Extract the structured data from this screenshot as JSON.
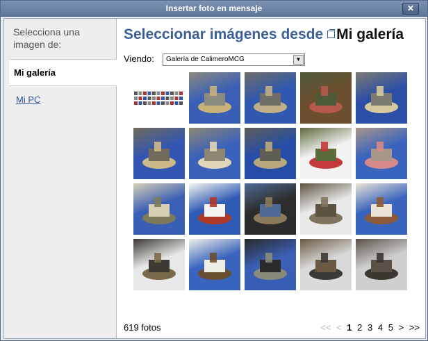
{
  "window": {
    "title": "Insertar foto en mensaje",
    "close_label": "✕"
  },
  "sidebar": {
    "heading": "Selecciona una imagen de:",
    "items": [
      {
        "label": "Mi galería",
        "active": true
      },
      {
        "label": "Mi PC",
        "active": false
      }
    ]
  },
  "main": {
    "heading_prefix": "Seleccionar imágenes desde",
    "heading_gallery": "Mi galería",
    "viewing_label": "Viendo:",
    "gallery_select_value": "Galería de CalimeroMCG"
  },
  "thumbnails": [
    {
      "name": "thumb-toolbar-screenshot",
      "type": "toolbar"
    },
    {
      "name": "thumb-model-1",
      "type": "photo",
      "colors": [
        "#3a5fb5",
        "#8a8a80",
        "#c9b17a"
      ]
    },
    {
      "name": "thumb-model-2",
      "type": "photo",
      "colors": [
        "#2f58b0",
        "#6e6e66",
        "#bfae88"
      ]
    },
    {
      "name": "thumb-model-3",
      "type": "photo",
      "colors": [
        "#6b4f2f",
        "#4d5a3a",
        "#b55a4a"
      ]
    },
    {
      "name": "thumb-model-4",
      "type": "photo",
      "colors": [
        "#2c4fa6",
        "#7b7b72",
        "#d6c9a0"
      ]
    },
    {
      "name": "thumb-model-5",
      "type": "photo",
      "colors": [
        "#3456b2",
        "#6f6a5a",
        "#cdb98a"
      ]
    },
    {
      "name": "thumb-model-6",
      "type": "photo",
      "colors": [
        "#3b62ba",
        "#8d8672",
        "#e0d6b8"
      ]
    },
    {
      "name": "thumb-model-7",
      "type": "photo",
      "colors": [
        "#264ea8",
        "#5e5e56",
        "#b9a77e"
      ]
    },
    {
      "name": "thumb-model-8",
      "type": "photo",
      "colors": [
        "#f2f2f2",
        "#5b6b3b",
        "#c43a3a"
      ]
    },
    {
      "name": "thumb-model-9",
      "type": "photo",
      "colors": [
        "#3a64bd",
        "#a8968a",
        "#d98a8a"
      ]
    },
    {
      "name": "thumb-model-10",
      "type": "photo",
      "colors": [
        "#3a5fb5",
        "#d8d0b6",
        "#7c7a5a"
      ]
    },
    {
      "name": "thumb-model-11",
      "type": "photo",
      "colors": [
        "#2f5bb4",
        "#f4f4f0",
        "#b03a2a"
      ]
    },
    {
      "name": "thumb-model-12",
      "type": "photo",
      "colors": [
        "#2c2c2c",
        "#4f6a96",
        "#8a7a5a"
      ]
    },
    {
      "name": "thumb-model-13",
      "type": "photo",
      "colors": [
        "#e9e9e9",
        "#5c5440",
        "#7f7460"
      ]
    },
    {
      "name": "thumb-model-14",
      "type": "photo",
      "colors": [
        "#3a64bd",
        "#e9e4d6",
        "#8b5a3a"
      ]
    },
    {
      "name": "thumb-model-15",
      "type": "photo",
      "colors": [
        "#e8e8e8",
        "#3c3a32",
        "#7a6a4a"
      ]
    },
    {
      "name": "thumb-model-16",
      "type": "photo",
      "colors": [
        "#3a64bd",
        "#efefe8",
        "#6a4e32"
      ]
    },
    {
      "name": "thumb-model-17",
      "type": "photo",
      "colors": [
        "#3a5fb5",
        "#2a2a2a",
        "#8a8a7a"
      ]
    },
    {
      "name": "thumb-model-18",
      "type": "photo",
      "colors": [
        "#d9d9d9",
        "#6a5a44",
        "#3a3a36"
      ]
    },
    {
      "name": "thumb-model-19",
      "type": "photo",
      "colors": [
        "#cfcfcf",
        "#5a5248",
        "#3a3630"
      ]
    }
  ],
  "footer": {
    "photo_count": "619 fotos",
    "pagination": {
      "first": "<<",
      "prev": "<",
      "pages": [
        "1",
        "2",
        "3",
        "4",
        "5"
      ],
      "current": "1",
      "next": ">",
      "last": ">>"
    }
  }
}
